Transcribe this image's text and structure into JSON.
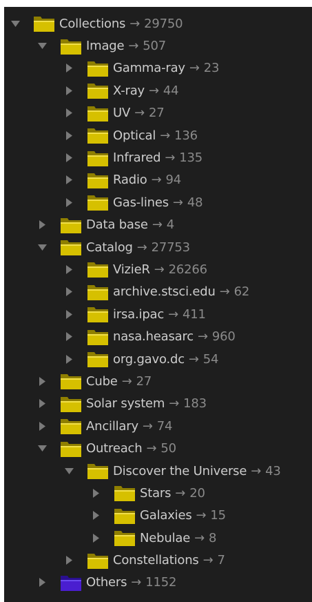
{
  "tree": {
    "separator": "→",
    "colors": {
      "folder": "#d6c000",
      "folder_special": "#4a1ed0"
    },
    "rows": [
      {
        "label": "Collections",
        "count": "29750",
        "level": 0,
        "expanded": true,
        "icon": "folder-icon"
      },
      {
        "label": "Image",
        "count": "507",
        "level": 1,
        "expanded": true,
        "icon": "folder-icon"
      },
      {
        "label": "Gamma-ray",
        "count": "23",
        "level": 2,
        "expanded": false,
        "icon": "folder-icon"
      },
      {
        "label": "X-ray",
        "count": "44",
        "level": 2,
        "expanded": false,
        "icon": "folder-icon"
      },
      {
        "label": "UV",
        "count": "27",
        "level": 2,
        "expanded": false,
        "icon": "folder-icon"
      },
      {
        "label": "Optical",
        "count": "136",
        "level": 2,
        "expanded": false,
        "icon": "folder-icon"
      },
      {
        "label": "Infrared",
        "count": "135",
        "level": 2,
        "expanded": false,
        "icon": "folder-icon"
      },
      {
        "label": "Radio",
        "count": "94",
        "level": 2,
        "expanded": false,
        "icon": "folder-icon"
      },
      {
        "label": "Gas-lines",
        "count": "48",
        "level": 2,
        "expanded": false,
        "icon": "folder-icon"
      },
      {
        "label": "Data base",
        "count": "4",
        "level": 1,
        "expanded": false,
        "icon": "folder-icon"
      },
      {
        "label": "Catalog",
        "count": "27753",
        "level": 1,
        "expanded": true,
        "icon": "folder-icon"
      },
      {
        "label": "VizieR",
        "count": "26266",
        "level": 2,
        "expanded": false,
        "icon": "folder-icon"
      },
      {
        "label": "archive.stsci.edu",
        "count": "62",
        "level": 2,
        "expanded": false,
        "icon": "folder-icon"
      },
      {
        "label": "irsa.ipac",
        "count": "411",
        "level": 2,
        "expanded": false,
        "icon": "folder-icon"
      },
      {
        "label": "nasa.heasarc",
        "count": "960",
        "level": 2,
        "expanded": false,
        "icon": "folder-icon"
      },
      {
        "label": "org.gavo.dc",
        "count": "54",
        "level": 2,
        "expanded": false,
        "icon": "folder-icon"
      },
      {
        "label": "Cube",
        "count": "27",
        "level": 1,
        "expanded": false,
        "icon": "folder-icon"
      },
      {
        "label": "Solar system",
        "count": "183",
        "level": 1,
        "expanded": false,
        "icon": "folder-icon"
      },
      {
        "label": "Ancillary",
        "count": "74",
        "level": 1,
        "expanded": false,
        "icon": "folder-icon"
      },
      {
        "label": "Outreach",
        "count": "50",
        "level": 1,
        "expanded": true,
        "icon": "folder-icon"
      },
      {
        "label": "Discover the Universe",
        "count": "43",
        "level": 2,
        "expanded": true,
        "icon": "folder-icon"
      },
      {
        "label": "Stars",
        "count": "20",
        "level": 3,
        "expanded": false,
        "icon": "folder-icon"
      },
      {
        "label": "Galaxies",
        "count": "15",
        "level": 3,
        "expanded": false,
        "icon": "folder-icon"
      },
      {
        "label": "Nebulae",
        "count": "8",
        "level": 3,
        "expanded": false,
        "icon": "folder-icon"
      },
      {
        "label": "Constellations",
        "count": "7",
        "level": 2,
        "expanded": false,
        "icon": "folder-icon"
      },
      {
        "label": "Others",
        "count": "1152",
        "level": 1,
        "expanded": false,
        "icon": "folder-special-icon"
      }
    ]
  }
}
